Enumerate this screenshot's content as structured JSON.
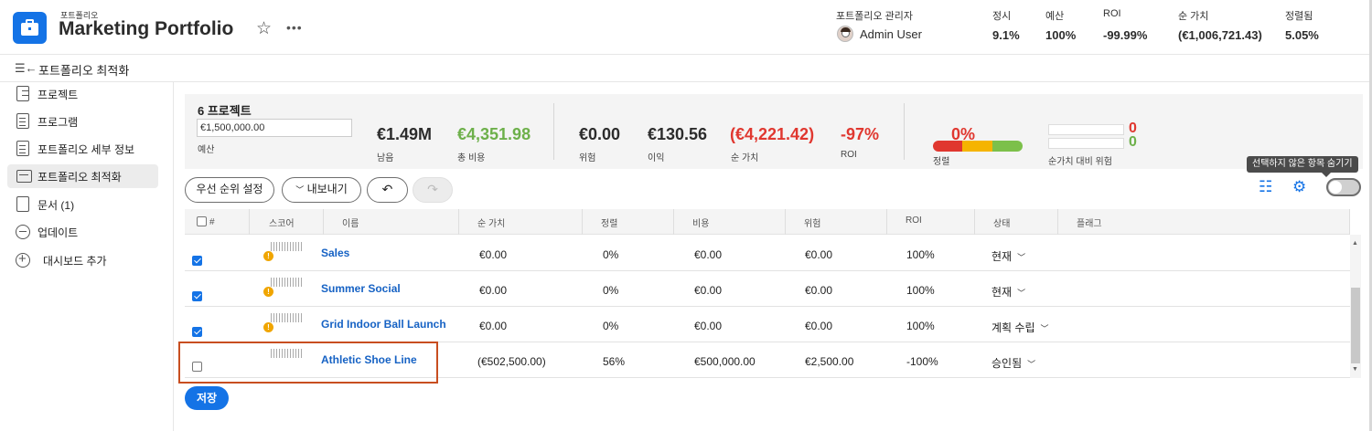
{
  "header": {
    "kicker": "포트폴리오",
    "title": "Marketing Portfolio",
    "admin_label": "포트폴리오 관리자",
    "admin_name": "Admin User",
    "metrics": [
      {
        "label": "정시",
        "value": "9.1%"
      },
      {
        "label": "예산",
        "value": "100%"
      },
      {
        "label": "ROI",
        "value": "-99.99%"
      },
      {
        "label": "순 가치",
        "value": "(€1,006,721.43)"
      },
      {
        "label": "정렬됨",
        "value": "5.05%"
      }
    ]
  },
  "subbar": {
    "title": "포트폴리오 최적화"
  },
  "sidebar": {
    "items": [
      {
        "label": "프로젝트",
        "icon": "project-list-icon"
      },
      {
        "label": "프로그램",
        "icon": "program-icon"
      },
      {
        "label": "포트폴리오 세부 정보",
        "icon": "details-icon"
      },
      {
        "label": "포트폴리오 최적화",
        "icon": "optimizer-icon",
        "active": true
      },
      {
        "label": "문서 (1)",
        "icon": "document-icon"
      },
      {
        "label": "업데이트",
        "icon": "updates-icon"
      },
      {
        "label": "대시보드 추가",
        "icon": "add-icon"
      }
    ]
  },
  "summary": {
    "project_count": "6 프로젝트",
    "budget_value": "€1,500,000.00",
    "budget_label": "예산",
    "metrics": [
      {
        "value": "€1.49M",
        "label": "남음"
      },
      {
        "value": "€4,351.98",
        "label": "총 비용"
      },
      {
        "value": "€0.00",
        "label": "위험"
      },
      {
        "value": "€130.56",
        "label": "이익"
      },
      {
        "value": "(€4,221.42)",
        "label": "순 가치"
      },
      {
        "value": "-97%",
        "label": "ROI"
      }
    ],
    "alignment": {
      "value": "0%",
      "label": "정렬"
    },
    "risk_vs_net": {
      "top": "0",
      "bottom": "0",
      "label": "순가치 대비 위험"
    }
  },
  "toolbar": {
    "prioritize": "우선 순위 설정",
    "export": "내보내기",
    "tooltip": "선택하지 않은 항목 숨기기"
  },
  "table": {
    "columns": [
      "#",
      "스코어",
      "이름",
      "순 가치",
      "정렬",
      "비용",
      "위험",
      "ROI",
      "상태",
      "플래그"
    ],
    "rows": [
      {
        "checked": true,
        "warn": true,
        "name": "Sales",
        "net": "€0.00",
        "align": "0%",
        "cost": "€0.00",
        "risk": "€0.00",
        "roi": "100%",
        "status": "현재"
      },
      {
        "checked": true,
        "warn": true,
        "name": "Summer Social",
        "net": "€0.00",
        "align": "0%",
        "cost": "€0.00",
        "risk": "€0.00",
        "roi": "100%",
        "status": "현재"
      },
      {
        "checked": true,
        "warn": true,
        "name": "Grid Indoor Ball Launch",
        "net": "€0.00",
        "align": "0%",
        "cost": "€0.00",
        "risk": "€0.00",
        "roi": "100%",
        "status": "계획 수립"
      },
      {
        "checked": false,
        "warn": false,
        "name": "Athletic Shoe Line",
        "net": "(€502,500.00)",
        "align": "56%",
        "cost": "€500,000.00",
        "risk": "€2,500.00",
        "roi": "-100%",
        "status": "승인됨"
      }
    ]
  },
  "save_label": "저장",
  "colors": {
    "accent": "#1473e6",
    "positive": "#6db04a",
    "negative": "#e0372f",
    "highlight": "#c84e20"
  }
}
